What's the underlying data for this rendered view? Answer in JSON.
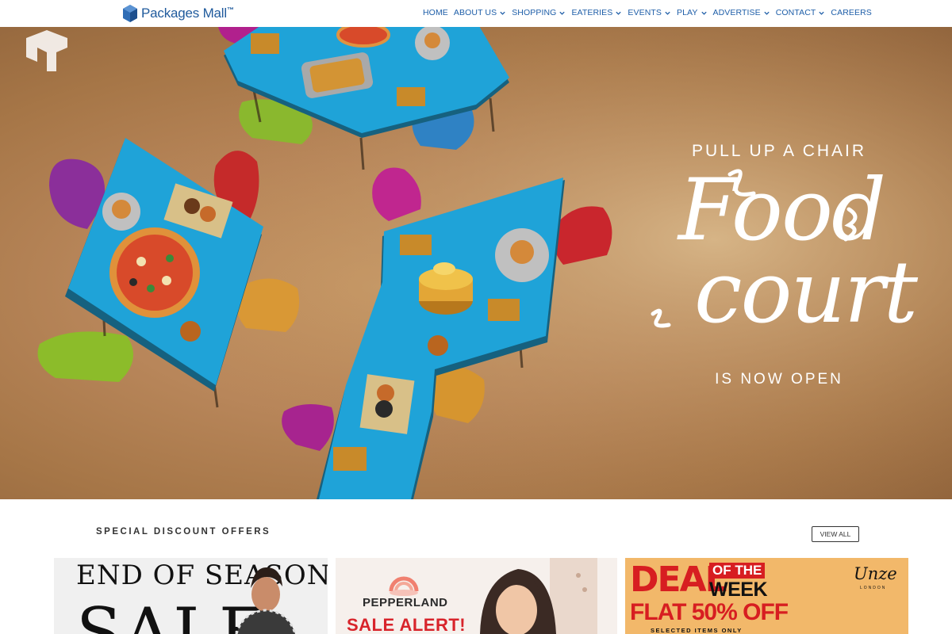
{
  "header": {
    "logo_text": "Packages Mall",
    "logo_mark": "™",
    "nav": [
      {
        "label": "HOME",
        "has_menu": false
      },
      {
        "label": "ABOUT US",
        "has_menu": true
      },
      {
        "label": "SHOPPING",
        "has_menu": true
      },
      {
        "label": "EATERIES",
        "has_menu": true
      },
      {
        "label": "EVENTS",
        "has_menu": true
      },
      {
        "label": "PLAY",
        "has_menu": true
      },
      {
        "label": "ADVERTISE",
        "has_menu": true
      },
      {
        "label": "CONTACT",
        "has_menu": true
      },
      {
        "label": "CAREERS",
        "has_menu": false
      }
    ]
  },
  "hero": {
    "kicker": "PULL UP A CHAIR",
    "title_line1": "Food",
    "title_line2": "court",
    "subtitle": "IS NOW OPEN"
  },
  "offers": {
    "section_title": "SPECIAL DISCOUNT OFFERS",
    "view_all_label": "VIEW ALL",
    "card1": {
      "headline": "END OF SEASON",
      "big": "SALE"
    },
    "card2": {
      "brand": "PEPPERLAND",
      "alert": "SALE ALERT!"
    },
    "card3": {
      "deal": "DEAL",
      "of_the": "OF THE",
      "week": "WEEK",
      "flat": "FLAT 50% OFF",
      "selected": "SELECTED ITEMS ONLY",
      "brand": "Unze",
      "brand_sub": "LONDON"
    }
  },
  "colors": {
    "nav_text": "#1e5ea8",
    "logo_blue": "#1f5a9c",
    "table_blue": "#1fa3d8",
    "sale_red": "#d71e21",
    "deal_bg": "#f2b86a"
  }
}
